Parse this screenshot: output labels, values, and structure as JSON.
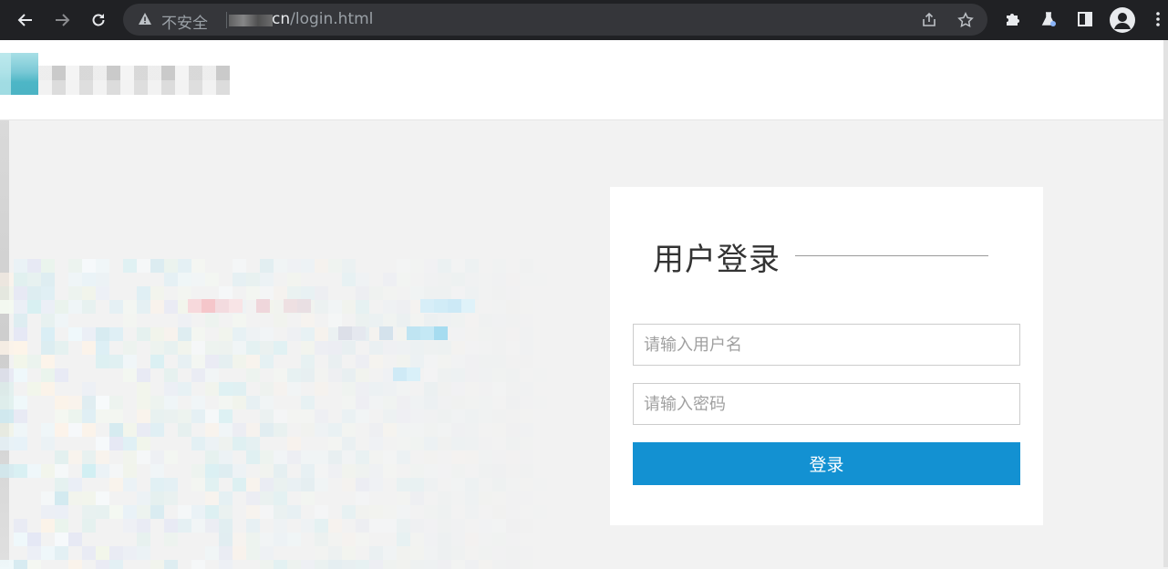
{
  "browser": {
    "security_label": "不安全",
    "url_host": "cn",
    "url_path": "/login.html",
    "icons": {
      "back": "arrow-left-icon",
      "forward": "arrow-right-icon",
      "reload": "reload-icon",
      "warning": "warning-triangle-icon",
      "share": "share-icon",
      "bookmark": "star-icon",
      "extensions": "puzzle-icon",
      "labs": "flask-icon",
      "sidepanel": "side-panel-icon",
      "profile": "avatar-icon",
      "menu": "kebab-menu-icon"
    }
  },
  "login": {
    "title": "用户登录",
    "username_placeholder": "请输入用户名",
    "password_placeholder": "请输入密码",
    "username_value": "",
    "password_value": "",
    "submit_label": "登录",
    "button_color": "#1391d2"
  }
}
